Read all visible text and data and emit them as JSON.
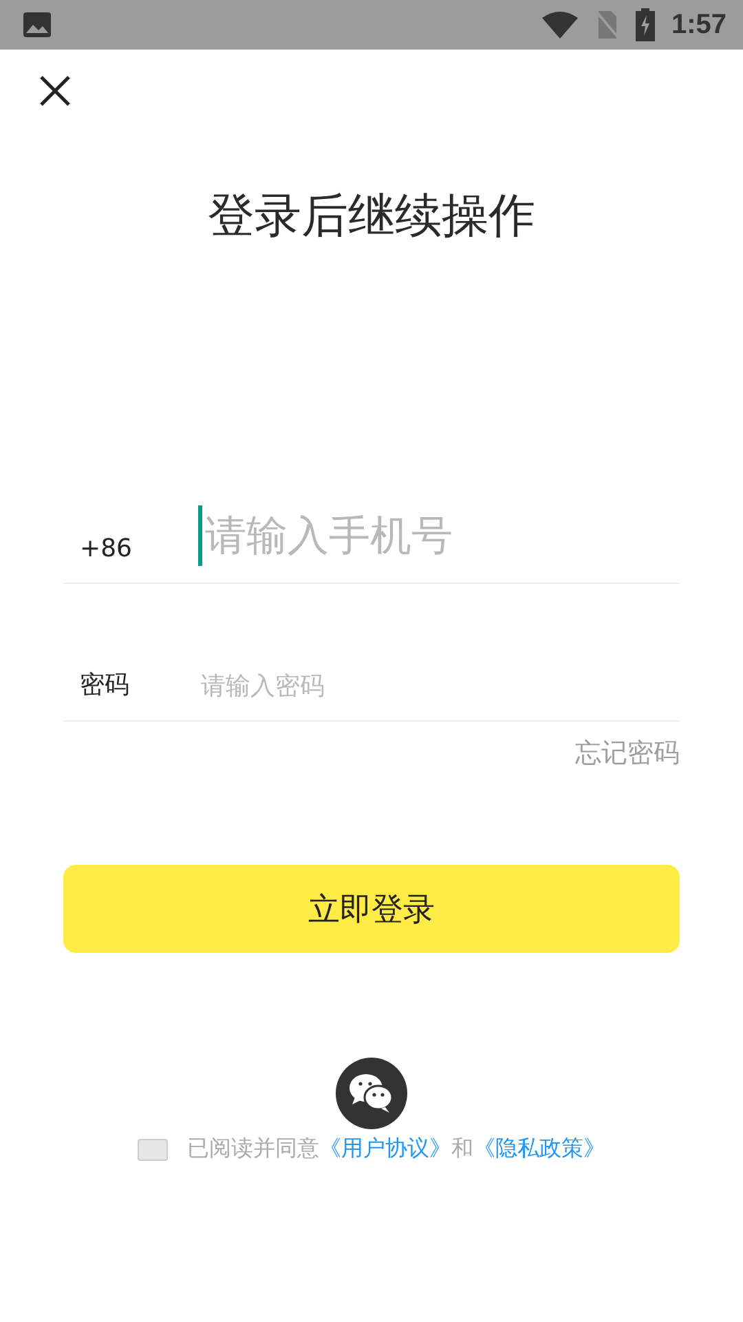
{
  "status_bar": {
    "time": "1:57"
  },
  "title": "登录后继续操作",
  "phone": {
    "prefix": "+86",
    "placeholder": "请输入手机号",
    "focused": true
  },
  "password": {
    "label": "密码",
    "placeholder": "请输入密码"
  },
  "forgot_link": "忘记密码",
  "login_button": "立即登录",
  "agreement": {
    "checked": false,
    "parts": [
      {
        "kind": "text",
        "text": "已阅读并同意"
      },
      {
        "kind": "link",
        "text": "《用户协议》"
      },
      {
        "kind": "text",
        "text": "和"
      },
      {
        "kind": "link",
        "text": "《隐私政策》"
      }
    ]
  }
}
